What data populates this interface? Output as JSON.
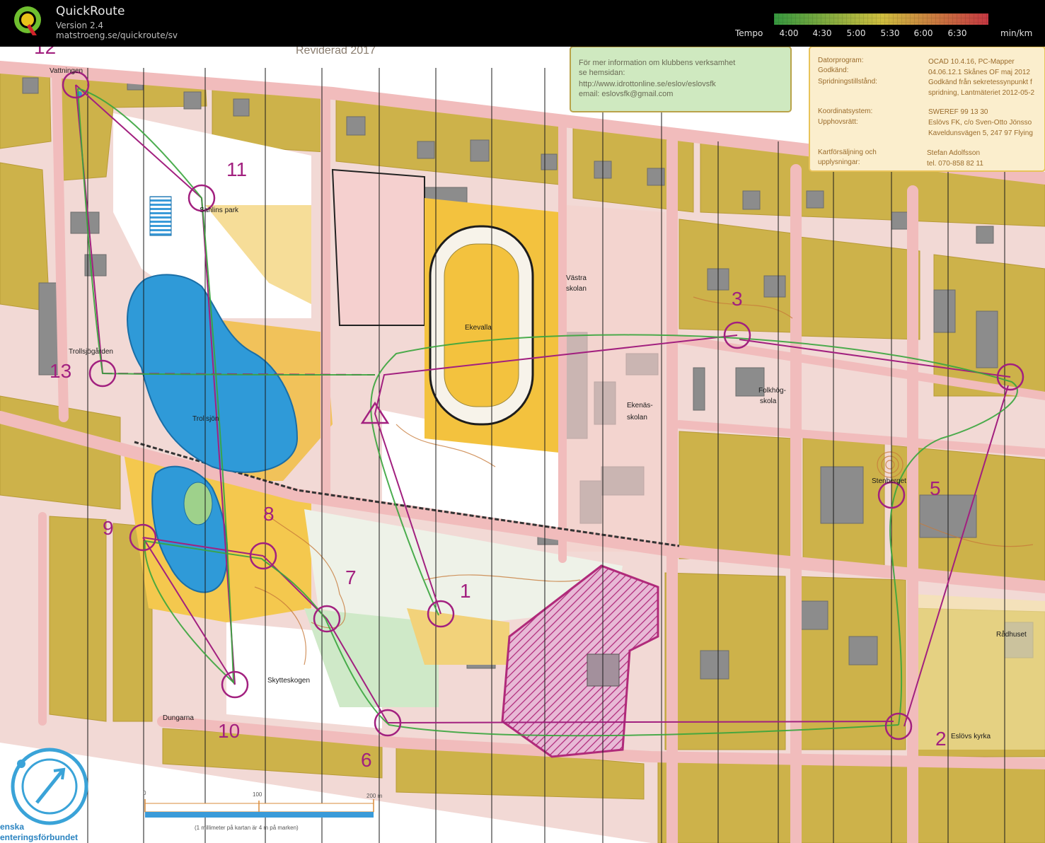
{
  "app": {
    "title": "QuickRoute",
    "version": "Version 2.4",
    "url": "matstroeng.se/quickroute/sv"
  },
  "tempo": {
    "label": "Tempo",
    "ticks": [
      "4:00",
      "4:30",
      "5:00",
      "5:30",
      "6:00",
      "6:30"
    ],
    "unit": "min/km",
    "colors": {
      "fast": "#3fb24a",
      "mid": "#f3e04a",
      "slow": "#e8414d"
    }
  },
  "map": {
    "revision": "Reviderad 2017",
    "info_box": {
      "line1": "För mer information om klubbens verksamhet",
      "line2": "se hemsidan:",
      "url": "http://www.idrottonline.se/eslov/eslovsfk",
      "email": "email: eslovsfk@gmail.com"
    },
    "meta": {
      "k1": "Datorprogram:",
      "v1": "OCAD 10.4.16, PC-Mapper",
      "k2": "Godkänd:",
      "v2": "04.06.12.1 Skånes OF maj 2012",
      "k3": "Spridningstillstånd:",
      "v3": "Godkänd från sekretessynpunkt f",
      "v3b": "spridning, Lantmäteriet 2012-05-2",
      "k4": "Koordinatsystem:",
      "v4": "SWEREF 99 13 30",
      "k5": "Upphovsrätt:",
      "v5": "Eslövs FK, c/o Sven-Otto Jönsso",
      "v5b": "Kaveldunsvägen 5, 247 97 Flying",
      "k6": "Kartförsäljning och",
      "k6b": "upplysningar:",
      "v6": "Stefan Adolfsson",
      "v6b": "tel. 070-858 82 11"
    },
    "place_names": {
      "vattningen": "Vattningen",
      "sahlins": "Sahlins park",
      "trollsjogarden": "Trollsjögården",
      "trollsjon": "Trollsjön",
      "ekevalla": "Ekevalla",
      "vastra1": "Västra",
      "vastra2": "skolan",
      "ekenas1": "Ekenäs-",
      "ekenas2": "skolan",
      "folkhog1": "Folkhög-",
      "folkhog2": "skola",
      "stenberget": "Stenberget",
      "skytteskogen": "Skytteskogen",
      "dungarna": "Dungarna",
      "radhuset": "Rådhuset",
      "eslovs_kyrka": "Eslövs kyrka"
    },
    "controls": {
      "c1": "1",
      "c2": "2",
      "c3": "3",
      "c5": "5",
      "c6": "6",
      "c7": "7",
      "c8": "8",
      "c9": "9",
      "c10": "10",
      "c11": "11",
      "c12": "12",
      "c13": "13"
    },
    "scale": {
      "t0": "0",
      "t100": "100",
      "t200": "200 m",
      "note": "(1 millimeter på kartan är 4 m på marken)"
    },
    "federation": {
      "line1": "enska",
      "line2": "enteringsförbundet"
    }
  }
}
